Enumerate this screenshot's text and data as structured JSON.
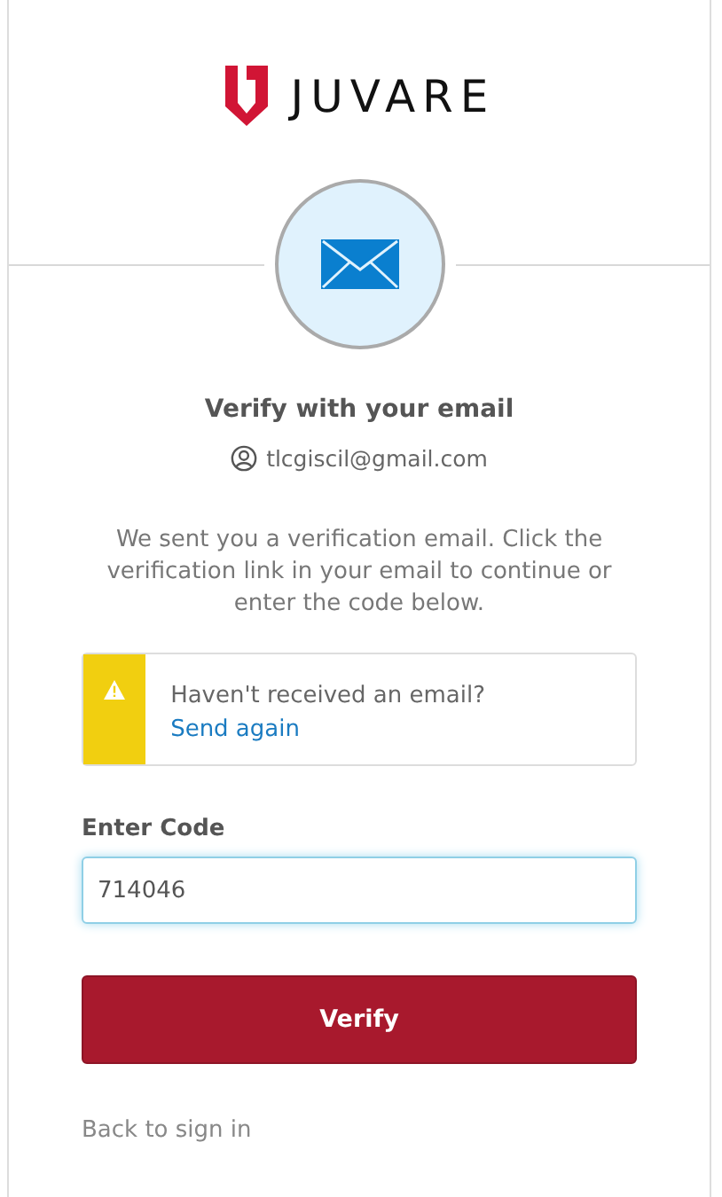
{
  "logo": {
    "wordmark": "JUVARE"
  },
  "title": "Verify with your email",
  "account": "tlcgiscil@gmail.com",
  "instructions": "We sent you a verification email. Click the verification link in your email to continue or enter the code below.",
  "alert": {
    "kind": "warning",
    "text": "Haven't received an email?",
    "link": "Send again"
  },
  "code_field": {
    "label": "Enter Code",
    "value": "714046",
    "focused": true
  },
  "buttons": [
    "Verify"
  ],
  "back_link": "Back to sign in"
}
